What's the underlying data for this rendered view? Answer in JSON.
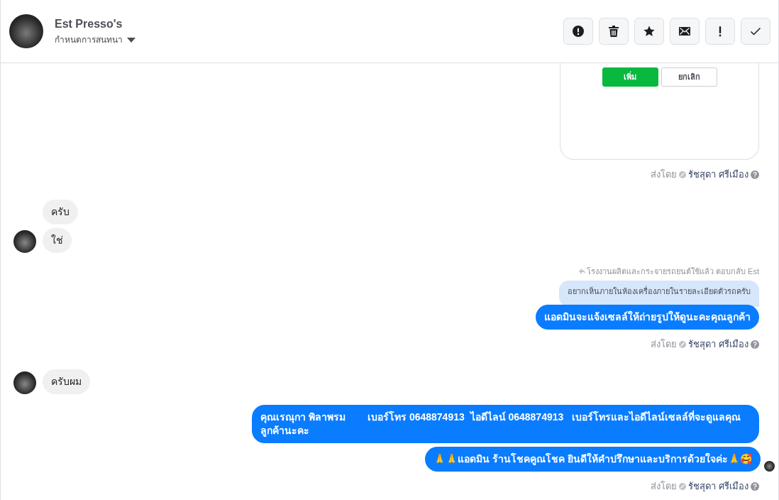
{
  "header": {
    "name": "Est Presso's",
    "subtitle": "กำหนดการสนทนา",
    "actions": [
      {
        "kind": "alert"
      },
      {
        "kind": "trash"
      },
      {
        "kind": "star"
      },
      {
        "kind": "mail"
      },
      {
        "kind": "exclaim"
      },
      {
        "kind": "check"
      }
    ]
  },
  "messages": [
    {
      "kind": "card",
      "buttons": [
        {
          "label": "เพิ่ม",
          "primary": true
        },
        {
          "label": "ยกเลิก",
          "primary": false
        }
      ]
    },
    {
      "kind": "meta",
      "prefix": "ส่งโดย",
      "sender": "รัชสุดา ศรีเมือง"
    },
    {
      "kind": "incoming",
      "text": "ครับ",
      "avatar": false
    },
    {
      "kind": "incoming",
      "text": "ใช่",
      "avatar": true
    },
    {
      "kind": "reply_note",
      "text": "โรงงานผลิตและกระจายรถยนต์ใช้แล้ว ตอบกลับ Est"
    },
    {
      "kind": "quote",
      "text": "อยากเห็นภายในห้องเครื่องภายในรายละเอียดตัวรถครับ"
    },
    {
      "kind": "outgoing",
      "text": "แอดมินจะแจ้งเซลล์ให้ถ่ายรูปให้ดูนะคะคุณลูกค้า",
      "seen": false
    },
    {
      "kind": "meta",
      "prefix": "ส่งโดย",
      "sender": "รัชสุดา ศรีเมือง"
    },
    {
      "kind": "incoming",
      "text": "ครับผม",
      "avatar": true
    },
    {
      "kind": "outgoing",
      "text": "คุณเรณุกา พิลาพรม        เบอร์โทร 0648874913  ไอดีไลน์ 0648874913   เบอร์โทรและไอดีไลน์เซลล์ที่จะดูแลคุณลูกค้านะคะ",
      "seen": false
    },
    {
      "kind": "outgoing",
      "text": "🙏🙏แอดมิน ร้านโชคคูณโชค ยินดีให้คำปรึกษาและบริการด้วยใจค่ะ🙏🥰",
      "seen": true
    },
    {
      "kind": "meta",
      "prefix": "ส่งโดย",
      "sender": "รัชสุดา ศรีเมือง"
    }
  ]
}
